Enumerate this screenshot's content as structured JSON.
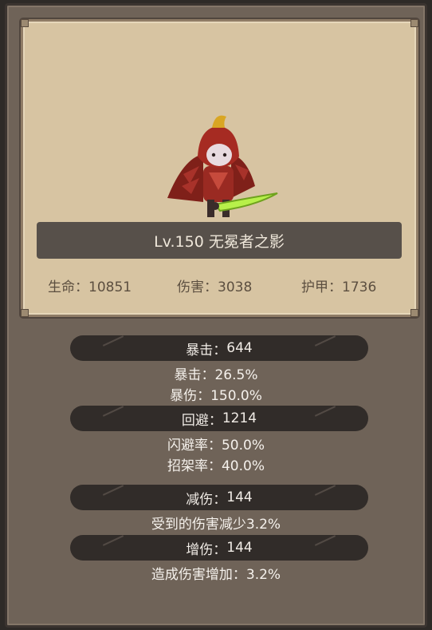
{
  "hero": {
    "level_name": "Lv.150 无冕者之影",
    "stats": [
      {
        "label": "生命：",
        "value": "10851"
      },
      {
        "label": "伤害：",
        "value": "3038"
      },
      {
        "label": "护甲：",
        "value": "1736"
      }
    ]
  },
  "sections": [
    {
      "header": "暴击：",
      "header_value": "644",
      "lines": [
        "暴击：26.5%",
        "暴伤：150.0%"
      ]
    },
    {
      "header": "回避：",
      "header_value": "1214",
      "lines": [
        "闪避率：50.0%",
        "招架率：40.0%"
      ]
    },
    {
      "header": "减伤：",
      "header_value": "144",
      "lines": [
        "受到的伤害减少3.2%"
      ]
    },
    {
      "header": "增伤：",
      "header_value": "144",
      "lines": [
        "造成伤害增加：3.2%"
      ]
    }
  ],
  "colors": {
    "panel": "#6f6358",
    "card": "#d7c4a2",
    "name_bar": "#57504a",
    "section_bar": "#312c29",
    "hero_cloak": "#9a2a22",
    "hero_blade": "#b7f04a"
  }
}
